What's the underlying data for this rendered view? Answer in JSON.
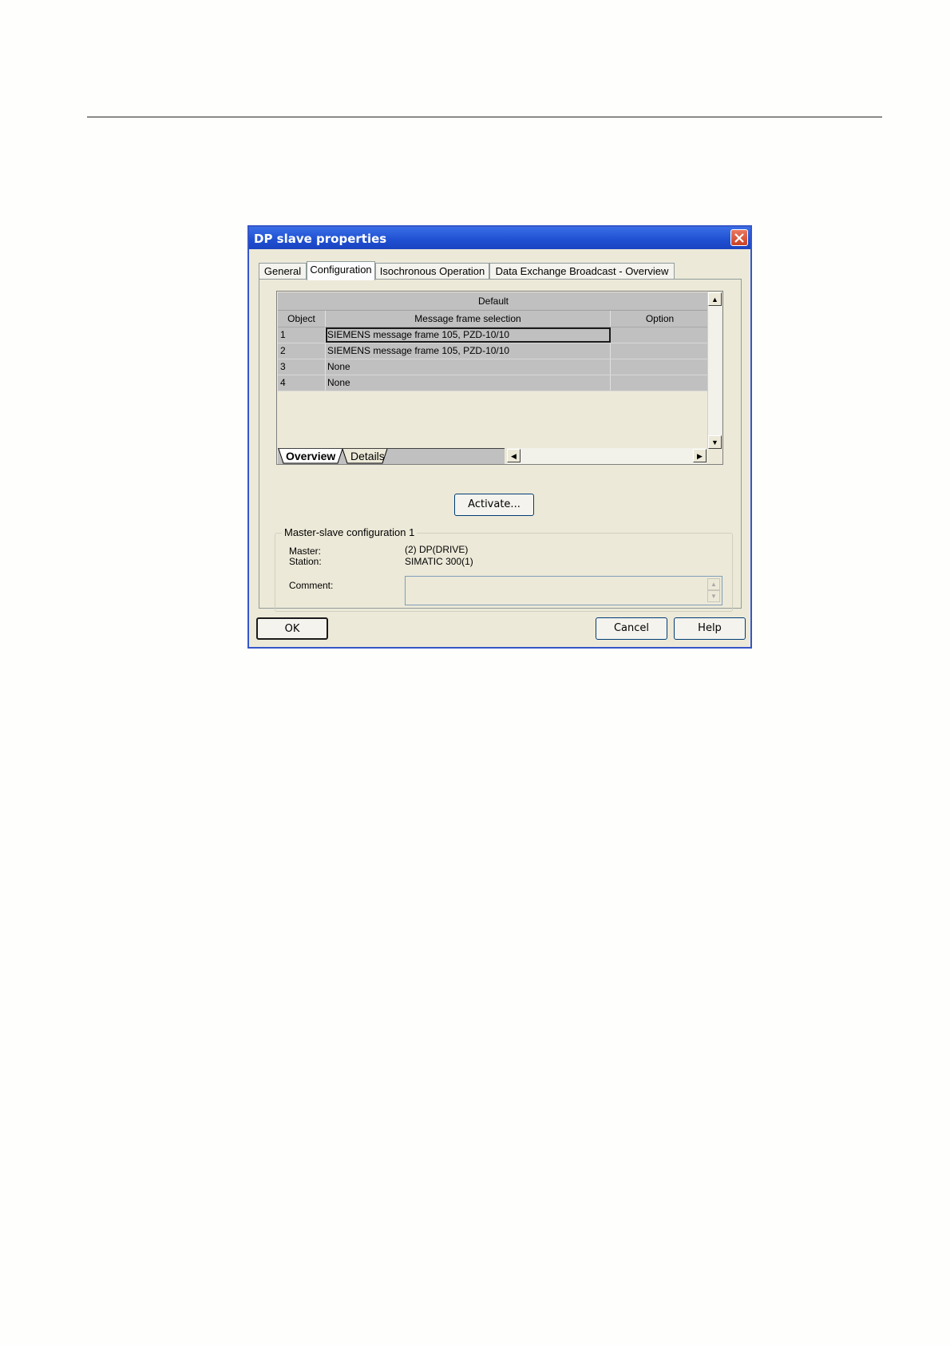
{
  "dialog": {
    "title": "DP slave properties",
    "tabs": [
      "General",
      "Configuration",
      "Isochronous Operation",
      "Data Exchange Broadcast - Overview"
    ],
    "active_tab": "Configuration",
    "grid": {
      "group_header": "Default",
      "columns": [
        "Object",
        "Message frame selection",
        "Option"
      ],
      "rows": [
        {
          "object": "1",
          "message": "SIEMENS message frame 105, PZD-10/10",
          "option": ""
        },
        {
          "object": "2",
          "message": "SIEMENS message frame 105, PZD-10/10",
          "option": ""
        },
        {
          "object": "3",
          "message": "None",
          "option": ""
        },
        {
          "object": "4",
          "message": "None",
          "option": ""
        }
      ],
      "sheet_tabs": [
        "Overview",
        "Details"
      ]
    },
    "activate_label": "Activate...",
    "master_slave": {
      "legend": "Master-slave configuration 1",
      "master_label": "Master:",
      "master_value": "(2) DP(DRIVE)",
      "station_label": "Station:",
      "station_value": "SIMATIC 300(1)",
      "comment_label": "Comment:"
    },
    "buttons": {
      "ok": "OK",
      "cancel": "Cancel",
      "help": "Help"
    }
  }
}
